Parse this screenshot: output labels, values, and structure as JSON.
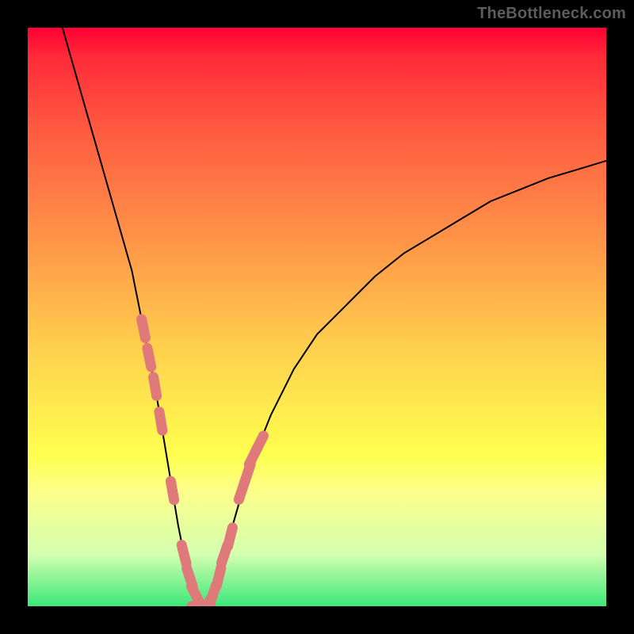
{
  "watermark": "TheBottleneck.com",
  "colors": {
    "page_bg": "#000000",
    "gradient_top": "#ff0033",
    "gradient_bottom": "#3ce87a",
    "curve_stroke": "#000000",
    "marker_fill": "#e07a7a",
    "marker_stroke": "#d86a6a"
  },
  "chart_data": {
    "type": "line",
    "title": "",
    "xlabel": "",
    "ylabel": "",
    "xlim": [
      0,
      100
    ],
    "ylim": [
      0,
      100
    ],
    "grid": false,
    "legend": false,
    "series": [
      {
        "name": "bottleneck-curve",
        "x": [
          6,
          8,
          10,
          12,
          14,
          16,
          18,
          20,
          22,
          24,
          25,
          26,
          27,
          28,
          29,
          30,
          31,
          32,
          33,
          34,
          36,
          38,
          40,
          42,
          44,
          46,
          48,
          50,
          55,
          60,
          65,
          70,
          75,
          80,
          85,
          90,
          95,
          100
        ],
        "y": [
          100,
          93,
          86,
          79,
          72,
          65,
          58,
          48,
          38,
          26,
          20,
          14,
          9,
          5,
          2,
          0,
          0,
          2,
          5,
          9,
          16,
          23,
          28,
          33,
          37,
          41,
          44,
          47,
          52,
          57,
          61,
          64,
          67,
          70,
          72,
          74,
          75.5,
          77
        ]
      }
    ],
    "sample_markers": {
      "name": "highlighted-samples",
      "x": [
        20,
        21,
        22,
        23,
        25,
        27,
        28,
        29,
        30,
        31,
        32,
        33,
        34,
        35,
        37,
        38,
        39,
        40
      ],
      "y": [
        48,
        43,
        38,
        32,
        20,
        9,
        5,
        2,
        0,
        0,
        2,
        5,
        9,
        12,
        20,
        23,
        26,
        28
      ]
    }
  }
}
